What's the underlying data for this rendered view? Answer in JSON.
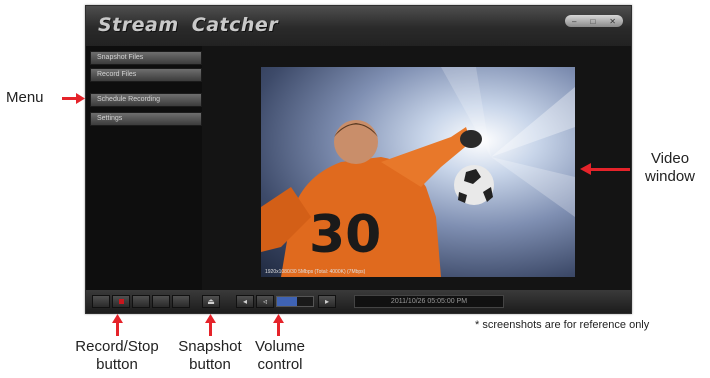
{
  "app": {
    "title": "Stream Catcher",
    "window_controls": [
      "–",
      "□",
      "✕"
    ]
  },
  "menu": {
    "items": [
      {
        "label": "Snapshot Files"
      },
      {
        "label": "Record Files"
      },
      {
        "label": "Schedule Recording"
      },
      {
        "label": "Settings"
      }
    ]
  },
  "video": {
    "caption": "1920x1080/30 5Mbps (Total: 4000K) (7Mbps)",
    "jersey_number": "30"
  },
  "controls": {
    "record_icon": "record-square-icon",
    "snapshot_icon": "camera-icon",
    "volume_level": 0.55,
    "timestamp": "2011/10/26 05:05:00 PM"
  },
  "annotations": {
    "menu": "Menu",
    "video_window_1": "Video",
    "video_window_2": "window",
    "record_1": "Record/Stop",
    "record_2": "button",
    "snapshot_1": "Snapshot",
    "snapshot_2": "button",
    "volume_1": "Volume",
    "volume_2": "control",
    "note": "* screenshots are for reference only"
  },
  "colors": {
    "annotation_arrow": "#e5232a",
    "volume_fill": "#3f63b4",
    "record": "#c8161d"
  }
}
